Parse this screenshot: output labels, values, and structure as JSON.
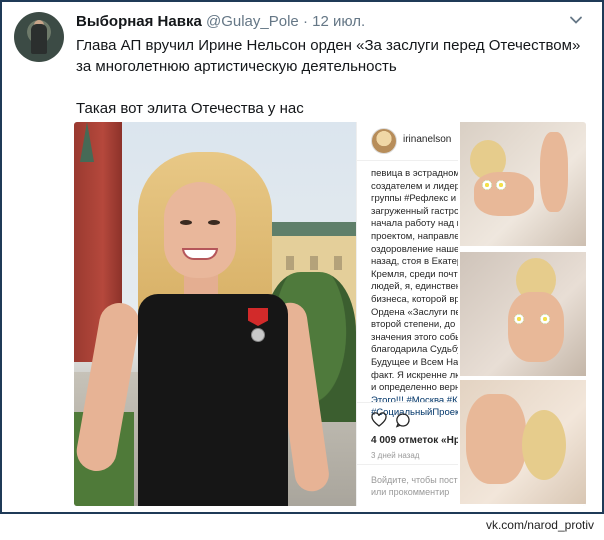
{
  "tweet": {
    "author_name": "Выборная Навка",
    "handle": "@Gulay_Pole",
    "separator": "·",
    "date": "12 июл.",
    "text_lines": [
      "Глава АП вручил Ирине Нельсон орден «За заслуги перед Отечеством» за многолетнюю артистическую деятельность",
      "Такая вот элита Отечества у нас"
    ],
    "icons": {
      "menu": "chevron-down-icon",
      "avatar": "avatar"
    }
  },
  "instagram": {
    "username": "irinanelson",
    "caption_lines": [
      "певица в эстрадном",
      "создателем и лидер",
      "группы #Рефлекс и с",
      "загруженный гастро",
      "начала работу над н",
      "проектом, направле",
      "оздоровление наше",
      "назад, стоя в Екатер",
      "Кремля, среди почте",
      "людей, я, единствен",
      "бизнеса, которой вр",
      "Ордена «Заслуги пер",
      "второй степени, до",
      "значения этого собы",
      "благодарила Судьбу",
      "Будущее и Всем Нам",
      "факт. Я искренне лю",
      "и определенно верн",
      "Этого!!! #Москва #К",
      "#СоциальныйПроек"
    ],
    "likes": "4 009 отметок «Нра",
    "time": "3 дней назад",
    "login_lines": [
      "Войдите, чтобы пост",
      "или прокомментир"
    ],
    "login_link": "Войдите",
    "icons": {
      "like": "heart-icon",
      "comment": "comment-icon"
    }
  },
  "watermark": "vk.com/narod_protiv",
  "colors": {
    "text": "#14171a",
    "muted": "#657786",
    "frame": "#1f3a57",
    "link": "#003569"
  }
}
